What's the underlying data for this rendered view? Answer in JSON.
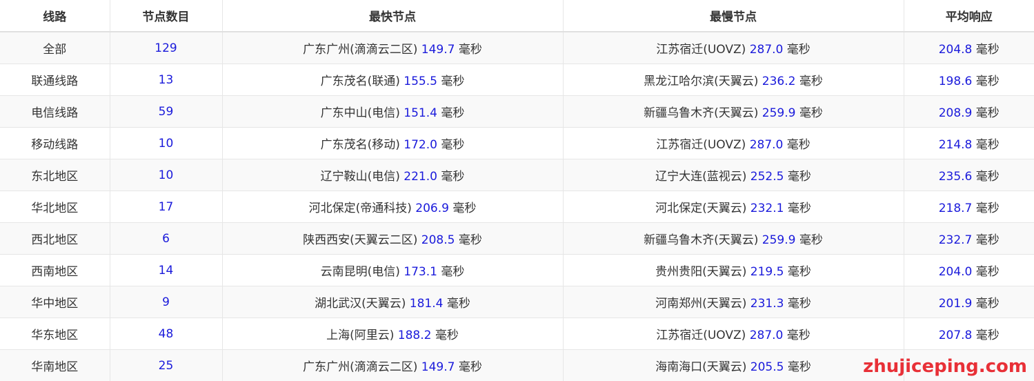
{
  "table": {
    "headers": [
      "线路",
      "节点数目",
      "最快节点",
      "最慢节点",
      "平均响应"
    ],
    "unit": "毫秒",
    "rows": [
      {
        "line": "全部",
        "count": "129",
        "fast_name": "广东广州(滴滴云二区)",
        "fast_ms": "149.7",
        "slow_name": "江苏宿迁(UOVZ)",
        "slow_ms": "287.0",
        "avg_ms": "204.8"
      },
      {
        "line": "联通线路",
        "count": "13",
        "fast_name": "广东茂名(联通)",
        "fast_ms": "155.5",
        "slow_name": "黑龙江哈尔滨(天翼云)",
        "slow_ms": "236.2",
        "avg_ms": "198.6"
      },
      {
        "line": "电信线路",
        "count": "59",
        "fast_name": "广东中山(电信)",
        "fast_ms": "151.4",
        "slow_name": "新疆乌鲁木齐(天翼云)",
        "slow_ms": "259.9",
        "avg_ms": "208.9"
      },
      {
        "line": "移动线路",
        "count": "10",
        "fast_name": "广东茂名(移动)",
        "fast_ms": "172.0",
        "slow_name": "江苏宿迁(UOVZ)",
        "slow_ms": "287.0",
        "avg_ms": "214.8"
      },
      {
        "line": "东北地区",
        "count": "10",
        "fast_name": "辽宁鞍山(电信)",
        "fast_ms": "221.0",
        "slow_name": "辽宁大连(蓝视云)",
        "slow_ms": "252.5",
        "avg_ms": "235.6"
      },
      {
        "line": "华北地区",
        "count": "17",
        "fast_name": "河北保定(帝通科技)",
        "fast_ms": "206.9",
        "slow_name": "河北保定(天翼云)",
        "slow_ms": "232.1",
        "avg_ms": "218.7"
      },
      {
        "line": "西北地区",
        "count": "6",
        "fast_name": "陕西西安(天翼云二区)",
        "fast_ms": "208.5",
        "slow_name": "新疆乌鲁木齐(天翼云)",
        "slow_ms": "259.9",
        "avg_ms": "232.7"
      },
      {
        "line": "西南地区",
        "count": "14",
        "fast_name": "云南昆明(电信)",
        "fast_ms": "173.1",
        "slow_name": "贵州贵阳(天翼云)",
        "slow_ms": "219.5",
        "avg_ms": "204.0"
      },
      {
        "line": "华中地区",
        "count": "9",
        "fast_name": "湖北武汉(天翼云)",
        "fast_ms": "181.4",
        "slow_name": "河南郑州(天翼云)",
        "slow_ms": "231.3",
        "avg_ms": "201.9"
      },
      {
        "line": "华东地区",
        "count": "48",
        "fast_name": "上海(阿里云)",
        "fast_ms": "188.2",
        "slow_name": "江苏宿迁(UOVZ)",
        "slow_ms": "287.0",
        "avg_ms": "207.8"
      },
      {
        "line": "华南地区",
        "count": "25",
        "fast_name": "广东广州(滴滴云二区)",
        "fast_ms": "149.7",
        "slow_name": "海南海口(天翼云)",
        "slow_ms": "205.5",
        "avg_ms": ""
      }
    ]
  },
  "watermark": {
    "text": "zhujiceping.com",
    "color": "#e8262d"
  },
  "colors": {
    "number": "#1a1adb",
    "text": "#333333",
    "stripe": "#f9f9f9",
    "border": "#e6e6e6"
  }
}
